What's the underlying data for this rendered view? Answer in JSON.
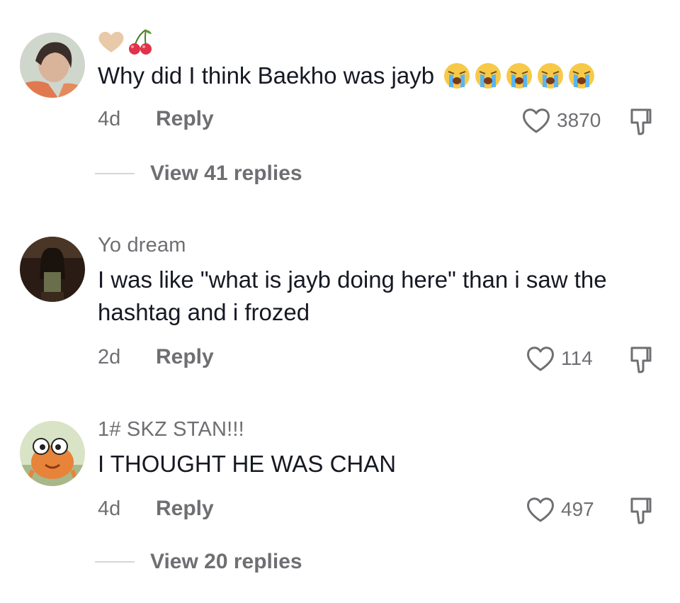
{
  "comments": [
    {
      "username": "",
      "text": "Why did I think Baekho was jayb",
      "time": "4d",
      "reply_label": "Reply",
      "likes": "3870",
      "view_replies": "View 41 replies",
      "name_emojis": [
        "heart-icon",
        "cherries-icon"
      ],
      "text_emojis": [
        "loudly-crying-face",
        "loudly-crying-face",
        "loudly-crying-face",
        "loudly-crying-face",
        "loudly-crying-face"
      ]
    },
    {
      "username": "Yo dream",
      "text": "I was like \"what is jayb doing here\" than i saw the hashtag and i frozed",
      "time": "2d",
      "reply_label": "Reply",
      "likes": "114"
    },
    {
      "username": "1# SKZ STAN!!!",
      "text": "I THOUGHT HE WAS CHAN",
      "time": "4d",
      "reply_label": "Reply",
      "likes": "497",
      "view_replies": "View 20 replies"
    }
  ],
  "colors": {
    "text_primary": "#161823",
    "text_secondary": "#6f6f73",
    "divider": "#d6d6d8",
    "heart_emoji": "#e8c9a8",
    "cherry": "#e0334a"
  }
}
